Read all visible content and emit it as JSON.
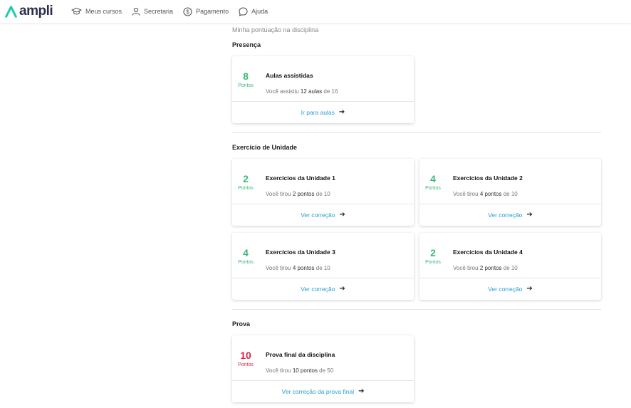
{
  "brand": {
    "name": "ampli",
    "color": "#1fc8b6"
  },
  "nav": [
    {
      "icon": "graduation-cap-icon",
      "label": "Meus cursos"
    },
    {
      "icon": "user-icon",
      "label": "Secretaria"
    },
    {
      "icon": "dollar-icon",
      "label": "Pagamento"
    },
    {
      "icon": "chat-bubble-icon",
      "label": "Ajuda"
    }
  ],
  "page": {
    "subtitle": "Minha pontuação na disciplina"
  },
  "colors": {
    "points_green": "#3cb878",
    "points_red": "#e0244a",
    "link": "#2a9fd0"
  },
  "sections": {
    "presenca": {
      "title": "Presença",
      "cards": [
        {
          "points": "8",
          "points_label": "Pontos",
          "title": "Aulas assistidas",
          "desc_prefix": "Você assistiu ",
          "desc_value": "12 aulas",
          "desc_suffix": " de 16",
          "link": "Ir para aulas"
        }
      ]
    },
    "exercicio": {
      "title": "Exercício de Unidade",
      "cards": [
        {
          "points": "2",
          "points_label": "Pontos",
          "title": "Exercícios da Unidade 1",
          "desc_prefix": "Você tirou ",
          "desc_value": "2 pontos",
          "desc_suffix": " de 10",
          "link": "Ver correção"
        },
        {
          "points": "4",
          "points_label": "Pontos",
          "title": "Exercícios da Unidade 2",
          "desc_prefix": "Você tirou ",
          "desc_value": "4 pontos",
          "desc_suffix": " de 10",
          "link": "Ver correção"
        },
        {
          "points": "4",
          "points_label": "Pontos",
          "title": "Exercícios da Unidade 3",
          "desc_prefix": "Você tirou ",
          "desc_value": "4 pontos",
          "desc_suffix": " de 10",
          "link": "Ver correção"
        },
        {
          "points": "2",
          "points_label": "Pontos",
          "title": "Exercícios da Unidade 4",
          "desc_prefix": "Você tirou ",
          "desc_value": "2 pontos",
          "desc_suffix": " de 10",
          "link": "Ver correção"
        }
      ]
    },
    "prova": {
      "title": "Prova",
      "cards": [
        {
          "points": "10",
          "points_label": "Pontos",
          "title": "Prova final da disciplina",
          "desc_prefix": "Você tirou ",
          "desc_value": "10 pontos",
          "desc_suffix": " de 50",
          "link": "Ver correção da prova final"
        }
      ]
    }
  }
}
